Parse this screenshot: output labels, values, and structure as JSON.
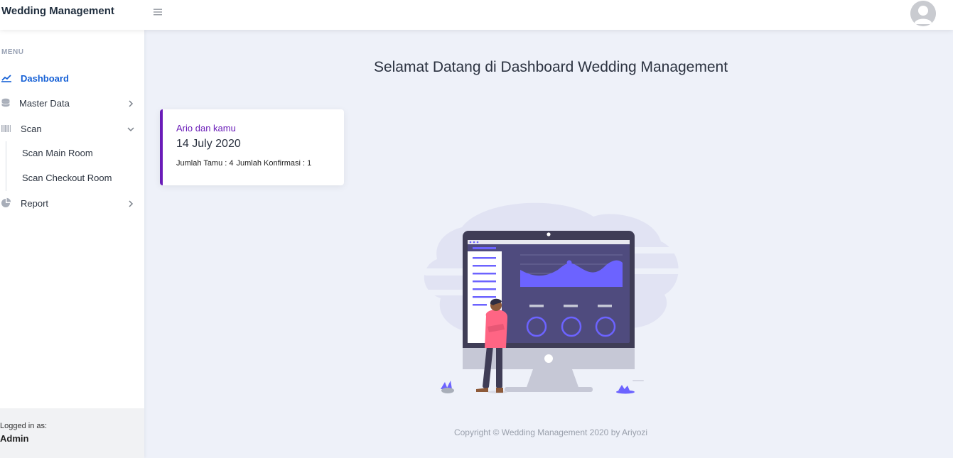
{
  "app": {
    "title": "Wedding Management"
  },
  "header": {
    "menu_icon": "hamburger-icon",
    "avatar_icon": "user-avatar-icon"
  },
  "sidebar": {
    "heading": "MENU",
    "items": [
      {
        "label": "Dashboard",
        "icon": "chart-line-icon",
        "active": true
      },
      {
        "label": "Master Data",
        "icon": "database-icon",
        "expandable": true,
        "expanded": false
      },
      {
        "label": "Scan",
        "icon": "barcode-icon",
        "expandable": true,
        "expanded": true,
        "children": [
          {
            "label": "Scan Main Room"
          },
          {
            "label": "Scan Checkout Room"
          }
        ]
      },
      {
        "label": "Report",
        "icon": "pie-chart-icon",
        "expandable": true,
        "expanded": false
      }
    ],
    "footer": {
      "logged_in_label": "Logged in as:",
      "user": "Admin"
    }
  },
  "main": {
    "title": "Selamat Datang di Dashboard Wedding Management",
    "event_card": {
      "name": "Ario dan kamu",
      "date": "14 July 2020",
      "guests": "Jumlah Tamu : 4",
      "confirmations": "Jumlah Konfirmasi : 1"
    },
    "illustration_icon": "dashboard-illustration"
  },
  "footer": {
    "copyright": "Copyright © Wedding Management 2020 by Ariyozi"
  },
  "colors": {
    "active_nav": "#1560d6",
    "card_accent": "#6a1cb8",
    "background": "#eef1f9",
    "illustration_primary": "#6c63ff",
    "illustration_dark": "#3f3d56"
  }
}
